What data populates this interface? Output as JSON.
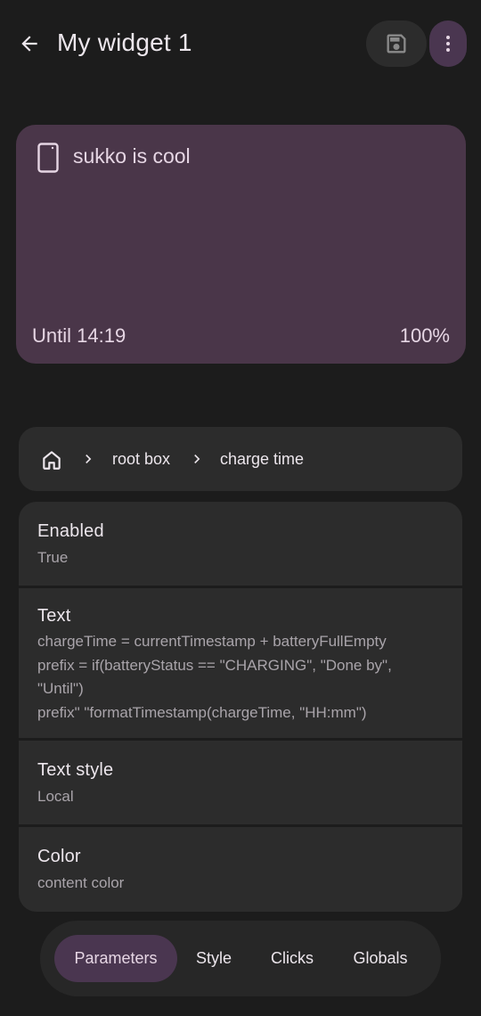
{
  "header": {
    "title": "My widget 1",
    "back_icon": "arrow-left-icon",
    "save_icon": "save-icon",
    "more_icon": "more-vertical-icon"
  },
  "preview": {
    "icon": "phone-icon",
    "text": "sukko is cool",
    "bottom_left": "Until 14:19",
    "bottom_right": "100%",
    "background_color": "#4a3649"
  },
  "breadcrumb": {
    "home_icon": "home-icon",
    "items": [
      "root box",
      "charge time"
    ]
  },
  "parameters": [
    {
      "label": "Enabled",
      "value": "True"
    },
    {
      "label": "Text",
      "value_lines": [
        "chargeTime = currentTimestamp + batteryFullEmpty",
        "prefix = if(batteryStatus == \"CHARGING\", \"Done by\",",
        "\"Until\")",
        "prefix\" \"formatTimestamp(chargeTime, \"HH:mm\")"
      ]
    },
    {
      "label": "Text style",
      "value": "Local"
    },
    {
      "label": "Color",
      "value": "content color"
    }
  ],
  "bottom_nav": {
    "tabs": [
      "Parameters",
      "Style",
      "Clicks",
      "Globals"
    ],
    "active": "Parameters"
  },
  "colors": {
    "background": "#1c1c1c",
    "surface": "#2c2c2c",
    "accent": "#4a3650"
  }
}
